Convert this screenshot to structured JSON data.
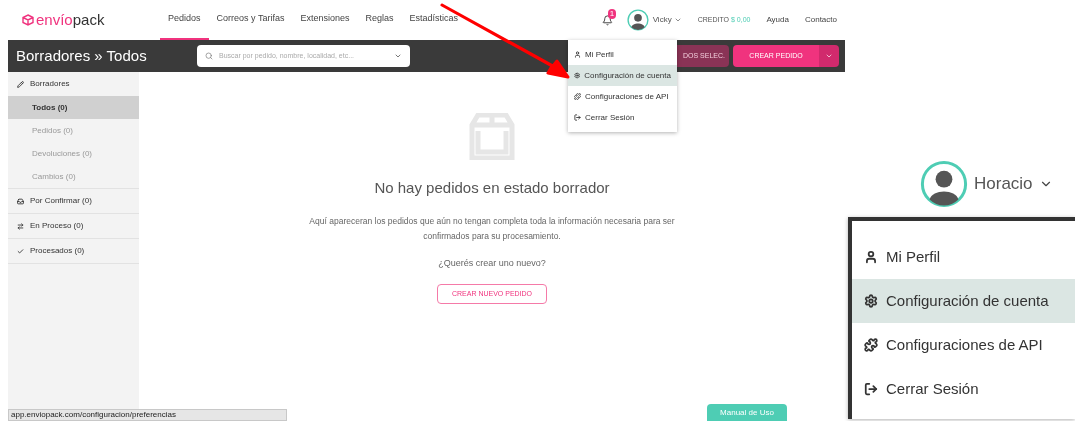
{
  "logo": {
    "brand": "envío",
    "suffix": "pack"
  },
  "nav_tabs": [
    {
      "label": "Pedidos",
      "selected": true
    },
    {
      "label": "Correos y Tarifas",
      "selected": false
    },
    {
      "label": "Extensiones",
      "selected": false
    },
    {
      "label": "Reglas",
      "selected": false
    },
    {
      "label": "Estadísticas",
      "selected": false
    }
  ],
  "user": {
    "notifications": "1",
    "name": "Vicky"
  },
  "credit": {
    "label": "CREDITO",
    "amount": "$ 0,00"
  },
  "links": [
    "Ayuda",
    "Contacto"
  ],
  "toolbar": {
    "title": "Borradores » Todos",
    "search": {
      "placeholder": "Buscar por pedido, nombre, localidad, etc..."
    },
    "bulk_button": "DOS SELEC.",
    "create_button": "CREAR PEDIDO"
  },
  "user_menu": [
    {
      "label": "Mi Perfil",
      "selected": false
    },
    {
      "label": "Configuración de cuenta",
      "selected": true
    },
    {
      "label": "Configuraciones de API",
      "selected": false
    },
    {
      "label": "Cerrar Sesión",
      "selected": false
    }
  ],
  "sidebar": [
    {
      "label": "Borradores",
      "children": [
        {
          "label": "Todos (0)",
          "selected": true
        },
        {
          "label": "Pedidos (0)",
          "selected": false
        },
        {
          "label": "Devoluciones (0)",
          "selected": false
        },
        {
          "label": "Cambios (0)",
          "selected": false
        }
      ]
    },
    {
      "label": "Por Confirmar (0)"
    },
    {
      "label": "En Proceso (0)"
    },
    {
      "label": "Procesados (0)"
    }
  ],
  "empty_state": {
    "title": "No hay pedidos en estado borrador",
    "description": "Aquí apareceran los pedidos que aún no tengan completa toda la información necesaria para ser confirmados para su procesamiento.",
    "question": "¿Querés crear uno nuevo?",
    "button": "CREAR NUEVO PEDIDO"
  },
  "status_url": "app.enviopack.com/configuracion/preferencias",
  "help_button": "Manual de Uso",
  "zoom_inset": {
    "user_name": "Horacio",
    "menu": [
      {
        "label": "Mi Perfil",
        "selected": false
      },
      {
        "label": "Configuración de cuenta",
        "selected": true
      },
      {
        "label": "Configuraciones de API",
        "selected": false
      },
      {
        "label": "Cerrar Sesión",
        "selected": false
      }
    ]
  }
}
